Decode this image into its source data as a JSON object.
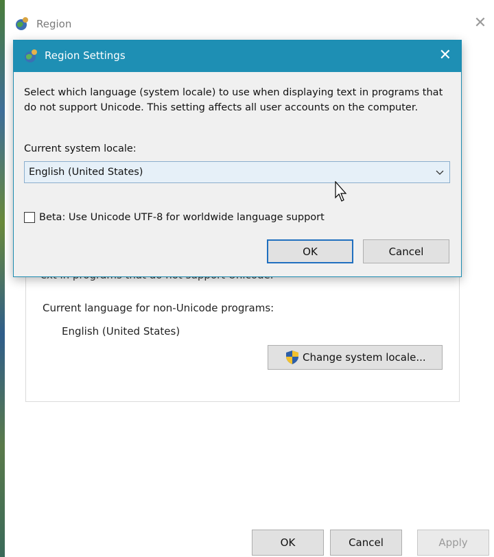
{
  "parent_window": {
    "title": "Region",
    "close_glyph": "✕",
    "obscured_text": "ext in programs that do not support Unicode.",
    "nonunicode_label": "Current language for non-Unicode programs:",
    "nonunicode_value": "English (United States)",
    "change_locale_label": "Change system locale...",
    "buttons": {
      "ok": "OK",
      "cancel": "Cancel",
      "apply": "Apply"
    }
  },
  "dialog": {
    "title": "Region Settings",
    "close_glyph": "✕",
    "description": "Select which language (system locale) to use when displaying text in programs that do not support Unicode. This setting affects all user accounts on the computer.",
    "locale_label": "Current system locale:",
    "locale_value": "English (United States)",
    "beta_label": "Beta: Use Unicode UTF-8 for worldwide language support",
    "beta_checked": false,
    "ok_label": "OK",
    "cancel_label": "Cancel"
  },
  "colors": {
    "dialog_titlebar": "#1e8fb4",
    "dialog_border": "#1b8bb0",
    "select_background": "#e6f0f8",
    "default_button_border": "#1f6fbf"
  },
  "icons": [
    "globe-icon",
    "close-icon",
    "chevron-down-icon",
    "shield-icon",
    "mouse-cursor-icon"
  ]
}
